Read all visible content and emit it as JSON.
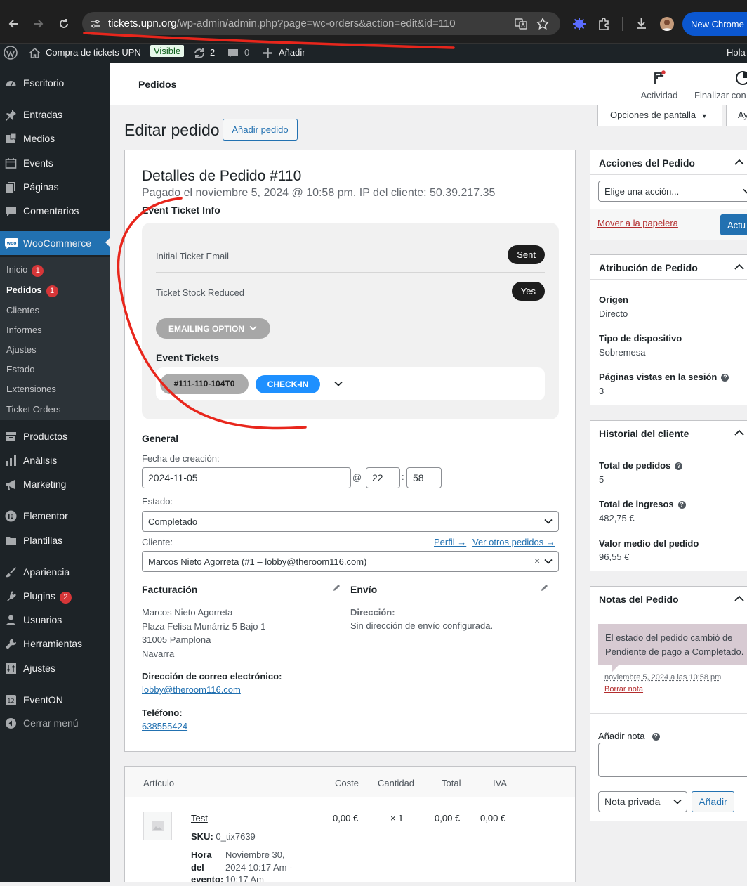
{
  "browser": {
    "url_host": "tickets.upn.org",
    "url_path": "/wp-admin/admin.php?page=wc-orders&action=edit&id=110",
    "new_chrome": "New Chrome"
  },
  "adminbar": {
    "site": "Compra de tickets UPN",
    "visible": "Visible",
    "updates": "2",
    "comments": "0",
    "add_new": "Añadir",
    "greeting": "Hola"
  },
  "sidebar": {
    "items": [
      {
        "label": "Escritorio"
      },
      {
        "label": "Entradas"
      },
      {
        "label": "Medios"
      },
      {
        "label": "Events"
      },
      {
        "label": "Páginas"
      },
      {
        "label": "Comentarios"
      },
      {
        "label": "WooCommerce"
      },
      {
        "label": "Productos"
      },
      {
        "label": "Análisis"
      },
      {
        "label": "Marketing"
      },
      {
        "label": "Elementor"
      },
      {
        "label": "Plantillas"
      },
      {
        "label": "Apariencia"
      },
      {
        "label": "Plugins",
        "badge": "2"
      },
      {
        "label": "Usuarios"
      },
      {
        "label": "Herramientas"
      },
      {
        "label": "Ajustes"
      },
      {
        "label": "EventON"
      },
      {
        "label": "Cerrar menú"
      }
    ],
    "sub": [
      {
        "label": "Inicio",
        "badge": "1"
      },
      {
        "label": "Pedidos",
        "badge": "1"
      },
      {
        "label": "Clientes"
      },
      {
        "label": "Informes"
      },
      {
        "label": "Ajustes"
      },
      {
        "label": "Estado"
      },
      {
        "label": "Extensiones"
      },
      {
        "label": "Ticket Orders"
      }
    ]
  },
  "header": {
    "title": "Pedidos",
    "activity": "Actividad",
    "finish_setup": "Finalizar con",
    "screen_options": "Opciones de pantalla",
    "help": "Ay"
  },
  "page": {
    "title": "Editar pedido",
    "add_order": "Añadir pedido"
  },
  "order": {
    "title": "Detalles de Pedido #110",
    "subtitle": "Pagado el noviembre 5, 2024 @ 10:58 pm. IP del cliente: 50.39.217.35",
    "event_ticket_info": "Event Ticket Info",
    "initial_email_label": "Initial Ticket Email",
    "initial_email_value": "Sent",
    "stock_label": "Ticket Stock Reduced",
    "stock_value": "Yes",
    "emailing_option": "EMAILING OPTION",
    "event_tickets": "Event Tickets",
    "ticket_id": "#111-110-104T0",
    "check_in": "CHECK-IN",
    "general": "General",
    "date_label": "Fecha de creación:",
    "date": "2024-11-05",
    "at": "@",
    "hour": "22",
    "minute": "58",
    "status_label": "Estado:",
    "status": "Completado",
    "customer_label": "Cliente:",
    "profile_link": "Perfil →",
    "other_orders_link": "Ver otros pedidos →",
    "customer": "Marcos Nieto Agorreta (#1 – lobby@theroom116.com)",
    "billing_title": "Facturación",
    "billing_address": [
      "Marcos Nieto Agorreta",
      "Plaza Felisa Munárriz 5 Bajo 1",
      "31005 Pamplona",
      "Navarra"
    ],
    "email_label": "Dirección de correo electrónico:",
    "email": "lobby@theroom116.com",
    "phone_label": "Teléfono:",
    "phone": "638555424",
    "shipping_title": "Envío",
    "shipping_address_label": "Dirección:",
    "shipping_address": "Sin dirección de envío configurada."
  },
  "items": {
    "headers": {
      "item": "Artículo",
      "cost": "Coste",
      "qty": "Cantidad",
      "total": "Total",
      "tax": "IVA"
    },
    "rows": [
      {
        "name": "Test",
        "sku_label": "SKU:",
        "sku": "0_tix7639",
        "meta_label": [
          "Hora",
          "del",
          "evento:"
        ],
        "meta_value": [
          "Noviembre 30,",
          "2024 10:17 Am -",
          "10:17 Am"
        ],
        "cost": "0,00 €",
        "qty": "× 1",
        "total": "0,00 €",
        "tax": "0,00 €"
      }
    ]
  },
  "actions": {
    "title": "Acciones del Pedido",
    "select": "Elige una acción...",
    "trash": "Mover a la papelera",
    "update": "Actu"
  },
  "attribution": {
    "title": "Atribución de Pedido",
    "origin_label": "Origen",
    "origin": "Directo",
    "device_label": "Tipo de dispositivo",
    "device": "Sobremesa",
    "pages_label": "Páginas vistas en la sesión",
    "pages": "3"
  },
  "history": {
    "title": "Historial del cliente",
    "orders_label": "Total de pedidos",
    "orders": "5",
    "revenue_label": "Total de ingresos",
    "revenue": "482,75 €",
    "avg_label": "Valor medio del pedido",
    "avg": "96,55 €"
  },
  "notes": {
    "title": "Notas del Pedido",
    "note_text": "El estado del pedido cambió de Pendiente de pago a Completado.",
    "note_date": "noviembre 5, 2024 a las 10:58 pm",
    "delete": "Borrar nota",
    "add_label": "Añadir nota",
    "type": "Nota privada",
    "add_button": "Añadir"
  },
  "colors": {
    "accent": "#2271b1",
    "sidebar": "#1d2327",
    "annotation": "#e8261c",
    "checkin": "#1e90ff"
  }
}
